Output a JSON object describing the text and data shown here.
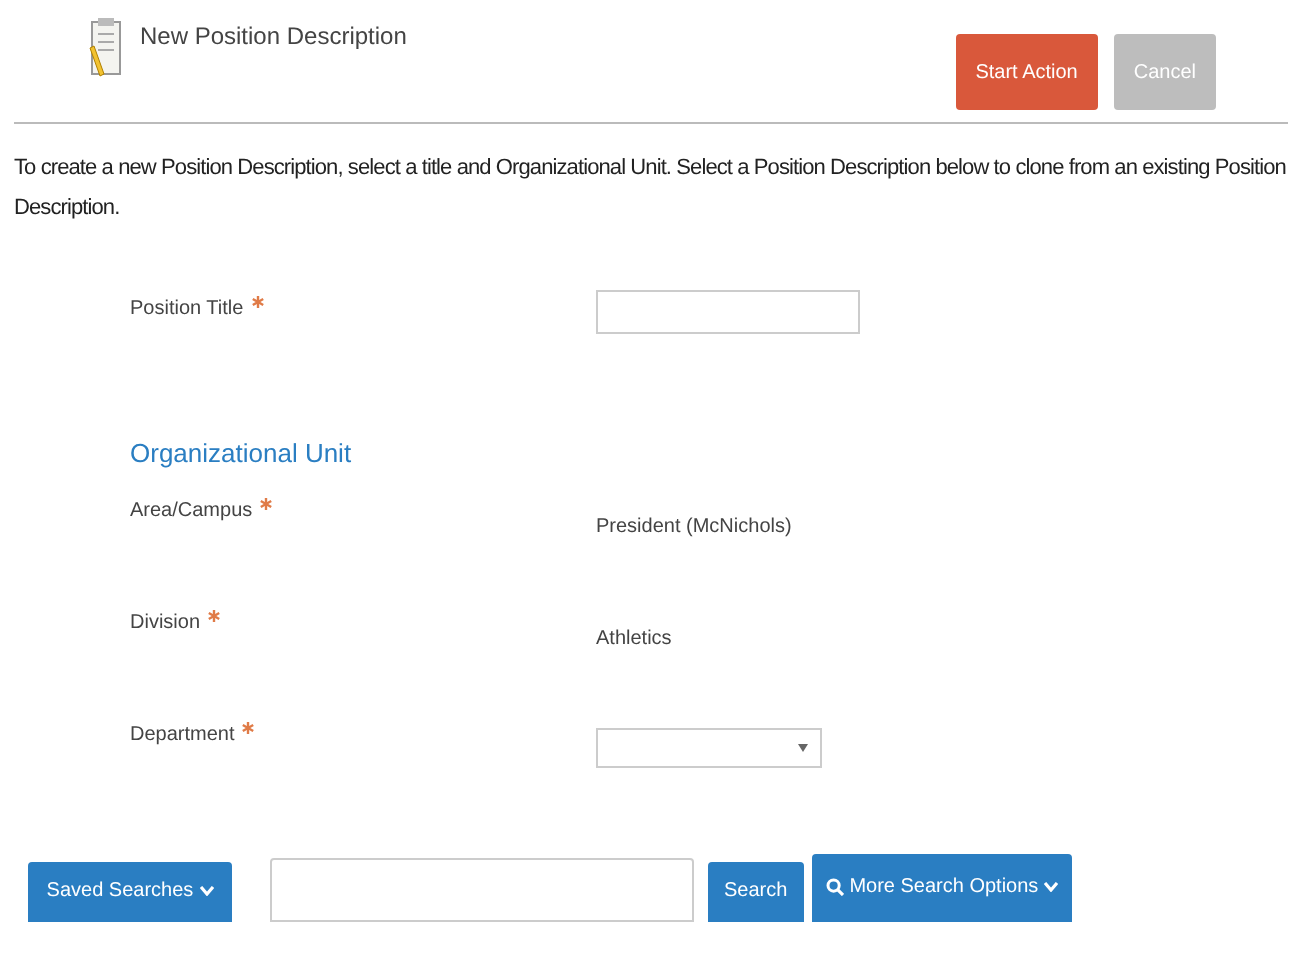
{
  "header": {
    "title": "New Position Description",
    "buttons": [
      {
        "label": "Start Action",
        "kind": "primary"
      },
      {
        "label": "Cancel",
        "kind": "secondary"
      }
    ]
  },
  "intro": "To create a new Position Description, select a title and Organizational Unit. Select a Position Description below to clone from an existing Position Description.",
  "title_field": {
    "label": "Position Title",
    "required": true,
    "kind": "text"
  },
  "section_heading": "Organizational Unit",
  "fields": [
    {
      "label": "Area/Campus",
      "required": true,
      "kind": "static",
      "value": "President (McNichols)"
    },
    {
      "label": "Division",
      "required": true,
      "kind": "static",
      "value": "Athletics"
    },
    {
      "label": "Department",
      "required": true,
      "kind": "select"
    }
  ],
  "search_bar": {
    "saved_searches": "Saved Searches",
    "search_button": "Search",
    "more_options": "More Search Options"
  }
}
